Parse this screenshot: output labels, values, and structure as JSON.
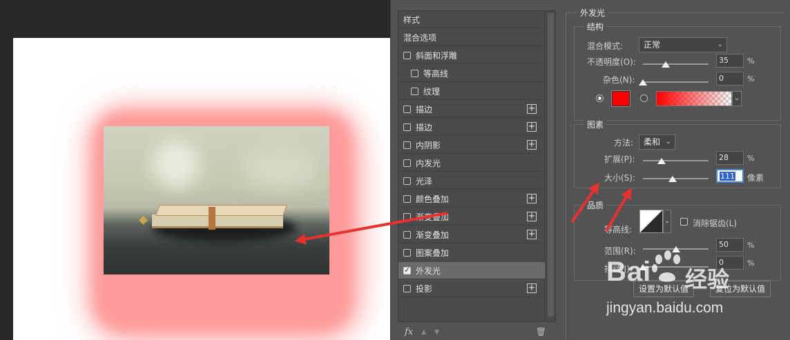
{
  "styles_panel": {
    "items": [
      {
        "label": "样式",
        "checkbox": false,
        "plus": false,
        "indent": 0,
        "active": false
      },
      {
        "label": "混合选项",
        "checkbox": false,
        "plus": false,
        "indent": 0,
        "active": false
      },
      {
        "label": "斜面和浮雕",
        "checkbox": true,
        "checked": false,
        "plus": false,
        "indent": 0,
        "active": false
      },
      {
        "label": "等高线",
        "checkbox": true,
        "checked": false,
        "plus": false,
        "indent": 1,
        "active": false
      },
      {
        "label": "纹理",
        "checkbox": true,
        "checked": false,
        "plus": false,
        "indent": 1,
        "active": false
      },
      {
        "label": "描边",
        "checkbox": true,
        "checked": false,
        "plus": true,
        "indent": 0,
        "active": false
      },
      {
        "label": "描边",
        "checkbox": true,
        "checked": false,
        "plus": true,
        "indent": 0,
        "active": false
      },
      {
        "label": "内阴影",
        "checkbox": true,
        "checked": false,
        "plus": true,
        "indent": 0,
        "active": false
      },
      {
        "label": "内发光",
        "checkbox": true,
        "checked": false,
        "plus": false,
        "indent": 0,
        "active": false
      },
      {
        "label": "光泽",
        "checkbox": true,
        "checked": false,
        "plus": false,
        "indent": 0,
        "active": false
      },
      {
        "label": "颜色叠加",
        "checkbox": true,
        "checked": false,
        "plus": true,
        "indent": 0,
        "active": false
      },
      {
        "label": "渐变叠加",
        "checkbox": true,
        "checked": false,
        "plus": true,
        "indent": 0,
        "active": false
      },
      {
        "label": "渐变叠加",
        "checkbox": true,
        "checked": false,
        "plus": true,
        "indent": 0,
        "active": false
      },
      {
        "label": "图案叠加",
        "checkbox": true,
        "checked": false,
        "plus": false,
        "indent": 0,
        "active": false
      },
      {
        "label": "外发光",
        "checkbox": true,
        "checked": true,
        "plus": false,
        "indent": 0,
        "active": true
      },
      {
        "label": "投影",
        "checkbox": true,
        "checked": false,
        "plus": true,
        "indent": 0,
        "active": false
      }
    ],
    "plus_symbol": "+",
    "fx_label": "fx",
    "up_icon": "▲",
    "down_icon": "▼",
    "trash_icon": "🗑"
  },
  "outer_glow": {
    "title": "外发光",
    "structure": {
      "legend": "结构",
      "blend_mode_label": "混合模式:",
      "blend_mode_value": "正常",
      "opacity_label": "不透明度(O):",
      "opacity_value": "35",
      "opacity_unit": "%",
      "noise_label": "杂色(N):",
      "noise_value": "0",
      "noise_unit": "%",
      "color_swatch": "#ff0000"
    },
    "elements": {
      "legend": "图素",
      "technique_label": "方法:",
      "technique_value": "柔和",
      "spread_label": "扩展(P):",
      "spread_value": "28",
      "spread_unit": "%",
      "size_label": "大小(S):",
      "size_value": "111",
      "size_unit": "像素"
    },
    "quality": {
      "legend": "品质",
      "contour_label": "等高线:",
      "antialias_label": "消除锯齿(L)",
      "range_label": "范围(R):",
      "range_value": "50",
      "range_unit": "%",
      "jitter_label": "抖动(J):",
      "jitter_value": "0",
      "jitter_unit": "%"
    },
    "buttons": {
      "set_default": "设置为默认值",
      "reset_default": "复位为默认值"
    }
  },
  "annotation_color": "#e8322f",
  "watermark": {
    "brand": "Bai",
    "brand2": "经验",
    "url": "jingyan.baidu.com"
  },
  "sliders": {
    "opacity": 0.35,
    "noise": 0.0,
    "spread": 0.28,
    "size": 0.45,
    "range": 0.5,
    "jitter": 0.0
  }
}
